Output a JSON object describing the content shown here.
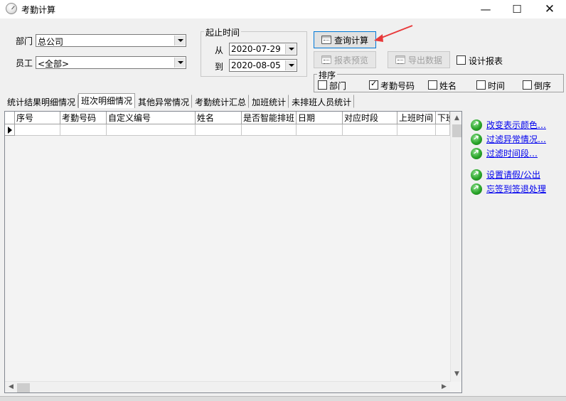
{
  "window": {
    "title": "考勤计算",
    "min_icon": "—",
    "max_icon": "☐",
    "close_icon": "✕"
  },
  "filters": {
    "dept_label": "部门",
    "dept_value": "总公司",
    "emp_label": "员工",
    "emp_value": "<全部>"
  },
  "period": {
    "title": "起止时间",
    "from_label": "从",
    "from_value": "2020-07-29",
    "to_label": "到",
    "to_value": "2020-08-05"
  },
  "actions": {
    "query_calc": "查询计算",
    "report_preview": "报表预览",
    "export_data": "导出数据",
    "design_report": "设计报表"
  },
  "sort": {
    "title": "排序",
    "options": [
      {
        "label": "部门",
        "checked": false
      },
      {
        "label": "考勤号码",
        "checked": true
      },
      {
        "label": "姓名",
        "checked": false
      },
      {
        "label": "时间",
        "checked": false
      },
      {
        "label": "倒序",
        "checked": false
      }
    ]
  },
  "tabs": [
    {
      "label": "统计结果明细情况",
      "active": false
    },
    {
      "label": "班次明细情况",
      "active": true
    },
    {
      "label": "其他异常情况",
      "active": false
    },
    {
      "label": "考勤统计汇总",
      "active": false
    },
    {
      "label": "加班统计",
      "active": false
    },
    {
      "label": "未排班人员统计",
      "active": false
    }
  ],
  "grid": {
    "columns": [
      "序号",
      "考勤号码",
      "自定义编号",
      "姓名",
      "是否智能排班",
      "日期",
      "对应时段",
      "上班时间",
      "下班"
    ]
  },
  "side_links": [
    {
      "label": "改变表示颜色…",
      "icon": "green-arrow-icon"
    },
    {
      "label": "过滤异常情况…",
      "icon": "green-arrow-icon"
    },
    {
      "label": "过滤时间段…",
      "icon": "green-arrow-icon"
    },
    {
      "label": "设置请假/公出",
      "icon": "green-arrow-icon"
    },
    {
      "label": "忘签到签退处理",
      "icon": "green-arrow-icon"
    }
  ],
  "colors": {
    "link": "#0000ee",
    "annotation_arrow": "#e8393a",
    "focus_border": "#0078d7"
  }
}
